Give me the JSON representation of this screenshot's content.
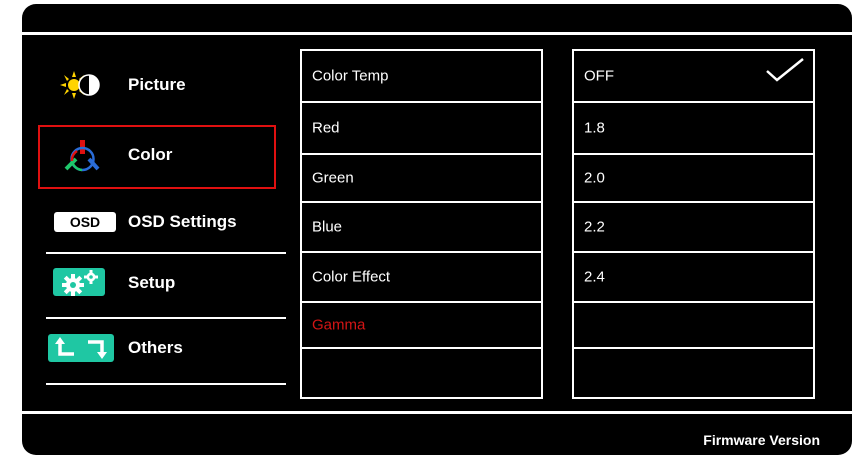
{
  "sidebar": {
    "items": [
      {
        "label": "Picture",
        "icon": "picture-icon"
      },
      {
        "label": "Color",
        "icon": "color-icon",
        "selected": true
      },
      {
        "label": "OSD Settings",
        "icon": "osd-icon",
        "icon_text": "OSD"
      },
      {
        "label": "Setup",
        "icon": "setup-icon"
      },
      {
        "label": "Others",
        "icon": "others-icon"
      }
    ],
    "selection_color": "#e01010",
    "icon_accent": "#1fc7a3"
  },
  "submenu": {
    "items": [
      "Color Temp",
      "Red",
      "Green",
      "Blue",
      "Color Effect",
      "Gamma",
      ""
    ],
    "active": "Gamma",
    "active_color": "#d41515"
  },
  "options": {
    "items": [
      "OFF",
      "1.8",
      "2.0",
      "2.2",
      "2.4",
      "",
      ""
    ],
    "checked": "OFF"
  },
  "footer": {
    "firmware_label": "Firmware Version"
  }
}
